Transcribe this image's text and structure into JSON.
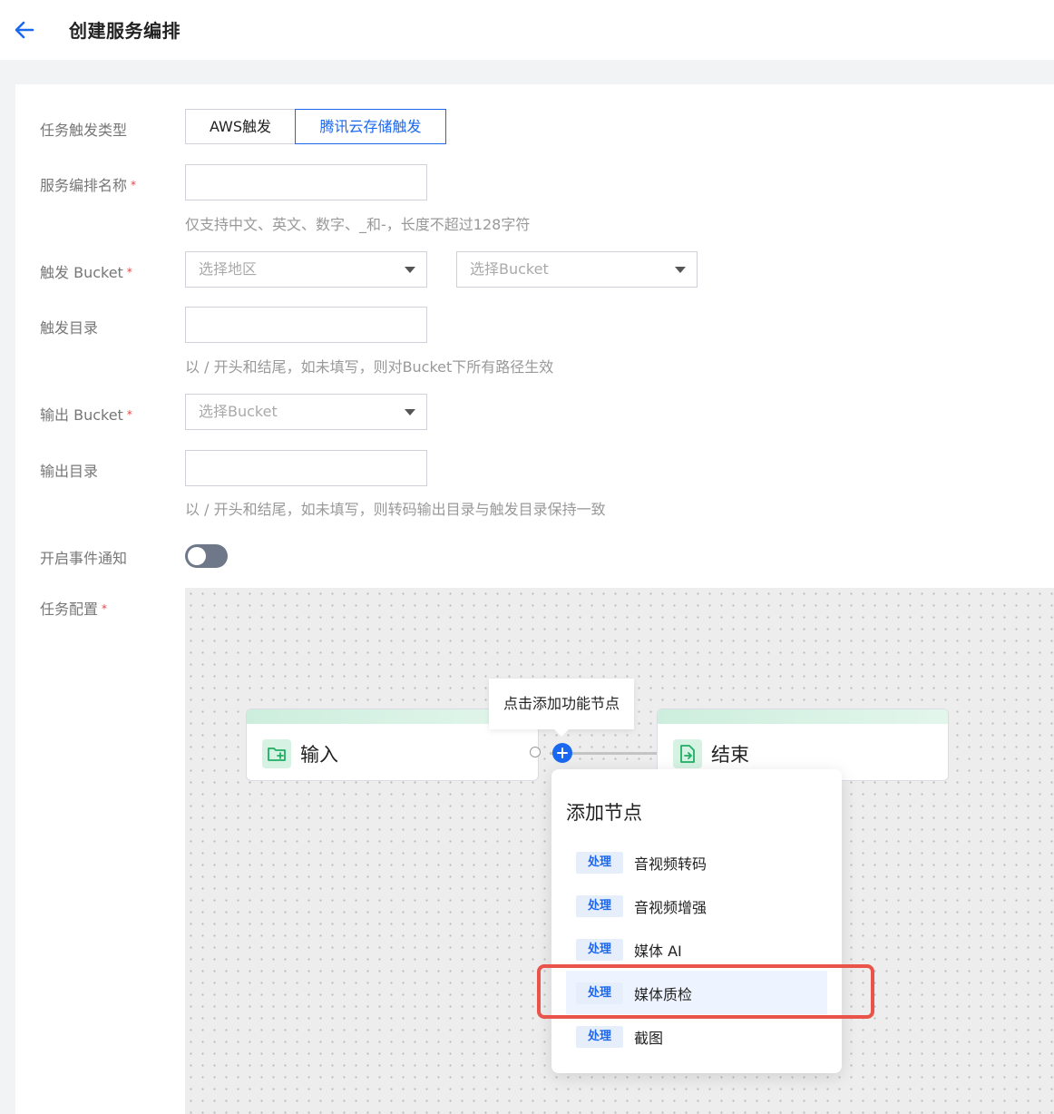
{
  "header": {
    "title": "创建服务编排"
  },
  "form": {
    "trigger_type": {
      "label": "任务触发类型",
      "options": [
        "AWS触发",
        "腾讯云存储触发"
      ],
      "selected": "腾讯云存储触发"
    },
    "name": {
      "label": "服务编排名称",
      "required_mark": "*",
      "value": "",
      "hint": "仅支持中文、英文、数字、_和-，长度不超过128字符"
    },
    "trigger_bucket": {
      "label": "触发 Bucket",
      "required_mark": "*",
      "region_placeholder": "选择地区",
      "bucket_placeholder": "选择Bucket"
    },
    "trigger_dir": {
      "label": "触发目录",
      "value": "",
      "hint": "以 / 开头和结尾，如未填写，则对Bucket下所有路径生效"
    },
    "output_bucket": {
      "label": "输出 Bucket",
      "required_mark": "*",
      "bucket_placeholder": "选择Bucket"
    },
    "output_dir": {
      "label": "输出目录",
      "value": "",
      "hint": "以 / 开头和结尾，如未填写，则转码输出目录与触发目录保持一致"
    },
    "event_notify": {
      "label": "开启事件通知",
      "enabled": false
    },
    "task_config": {
      "label": "任务配置",
      "required_mark": "*"
    }
  },
  "workflow": {
    "input_node": {
      "label": "输入",
      "icon": "folder-plus-icon"
    },
    "end_node": {
      "label": "结束",
      "icon": "file-export-icon"
    },
    "tooltip": "点击添加功能节点",
    "add_menu": {
      "title": "添加节点",
      "items": [
        {
          "tag": "处理",
          "label": "音视频转码"
        },
        {
          "tag": "处理",
          "label": "音视频增强"
        },
        {
          "tag": "处理",
          "label": "媒体 AI"
        },
        {
          "tag": "处理",
          "label": "媒体质检"
        },
        {
          "tag": "处理",
          "label": "截图"
        }
      ],
      "highlighted_item": "媒体质检"
    }
  },
  "colors": {
    "accent": "#1b68f0",
    "required": "#e54545",
    "highlight_border": "#e9534a",
    "node_stripe": "#cdeedd"
  }
}
